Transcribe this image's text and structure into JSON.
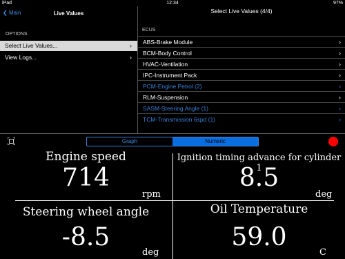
{
  "status_bar": {
    "device": "iPad",
    "time": "12:34",
    "battery": "97%"
  },
  "left": {
    "back_label": "Main",
    "title": "Live Values",
    "options_label": "OPTIONS",
    "items": [
      {
        "label": "Select Live Values..."
      },
      {
        "label": "View Logs..."
      }
    ]
  },
  "right": {
    "title": "Select Live Values (4/4)",
    "ecus_label": "ECUS",
    "items": [
      {
        "label": "ABS-Brake Module"
      },
      {
        "label": "BCM-Body Control"
      },
      {
        "label": "HVAC-Ventilation"
      },
      {
        "label": "IPC-Instrument Pack"
      },
      {
        "label": "PCM-Engine Petrol (2)"
      },
      {
        "label": "RLM-Suspension"
      },
      {
        "label": "SASM-Steering Angle (1)"
      },
      {
        "label": "TCM-Transmission 6spd (1)"
      }
    ]
  },
  "tabs": {
    "graph": "Graph",
    "numeric": "Numeric"
  },
  "readings": {
    "engine_speed": {
      "title": "Engine speed",
      "value": "714",
      "unit": "rpm"
    },
    "ignition": {
      "title": "Ignition timing advance for cylinder 1",
      "value": "8.5",
      "unit": "deg"
    },
    "steering": {
      "title": "Steering wheel angle",
      "value": "-8.5",
      "unit": "deg"
    },
    "oil": {
      "title": "Oil Temperature",
      "value": "59.0",
      "unit": "C"
    }
  },
  "colors": {
    "accent": "#3a7fd6",
    "record": "#ff0000"
  }
}
